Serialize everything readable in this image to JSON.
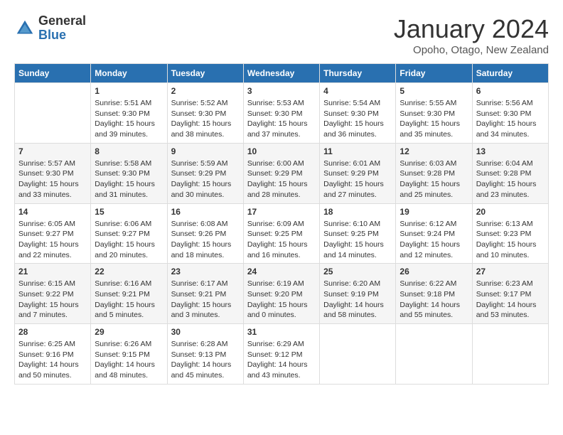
{
  "logo": {
    "general": "General",
    "blue": "Blue"
  },
  "title": "January 2024",
  "location": "Opoho, Otago, New Zealand",
  "days_of_week": [
    "Sunday",
    "Monday",
    "Tuesday",
    "Wednesday",
    "Thursday",
    "Friday",
    "Saturday"
  ],
  "weeks": [
    [
      {
        "day": "",
        "info": ""
      },
      {
        "day": "1",
        "info": "Sunrise: 5:51 AM\nSunset: 9:30 PM\nDaylight: 15 hours\nand 39 minutes."
      },
      {
        "day": "2",
        "info": "Sunrise: 5:52 AM\nSunset: 9:30 PM\nDaylight: 15 hours\nand 38 minutes."
      },
      {
        "day": "3",
        "info": "Sunrise: 5:53 AM\nSunset: 9:30 PM\nDaylight: 15 hours\nand 37 minutes."
      },
      {
        "day": "4",
        "info": "Sunrise: 5:54 AM\nSunset: 9:30 PM\nDaylight: 15 hours\nand 36 minutes."
      },
      {
        "day": "5",
        "info": "Sunrise: 5:55 AM\nSunset: 9:30 PM\nDaylight: 15 hours\nand 35 minutes."
      },
      {
        "day": "6",
        "info": "Sunrise: 5:56 AM\nSunset: 9:30 PM\nDaylight: 15 hours\nand 34 minutes."
      }
    ],
    [
      {
        "day": "7",
        "info": "Sunrise: 5:57 AM\nSunset: 9:30 PM\nDaylight: 15 hours\nand 33 minutes."
      },
      {
        "day": "8",
        "info": "Sunrise: 5:58 AM\nSunset: 9:30 PM\nDaylight: 15 hours\nand 31 minutes."
      },
      {
        "day": "9",
        "info": "Sunrise: 5:59 AM\nSunset: 9:29 PM\nDaylight: 15 hours\nand 30 minutes."
      },
      {
        "day": "10",
        "info": "Sunrise: 6:00 AM\nSunset: 9:29 PM\nDaylight: 15 hours\nand 28 minutes."
      },
      {
        "day": "11",
        "info": "Sunrise: 6:01 AM\nSunset: 9:29 PM\nDaylight: 15 hours\nand 27 minutes."
      },
      {
        "day": "12",
        "info": "Sunrise: 6:03 AM\nSunset: 9:28 PM\nDaylight: 15 hours\nand 25 minutes."
      },
      {
        "day": "13",
        "info": "Sunrise: 6:04 AM\nSunset: 9:28 PM\nDaylight: 15 hours\nand 23 minutes."
      }
    ],
    [
      {
        "day": "14",
        "info": "Sunrise: 6:05 AM\nSunset: 9:27 PM\nDaylight: 15 hours\nand 22 minutes."
      },
      {
        "day": "15",
        "info": "Sunrise: 6:06 AM\nSunset: 9:27 PM\nDaylight: 15 hours\nand 20 minutes."
      },
      {
        "day": "16",
        "info": "Sunrise: 6:08 AM\nSunset: 9:26 PM\nDaylight: 15 hours\nand 18 minutes."
      },
      {
        "day": "17",
        "info": "Sunrise: 6:09 AM\nSunset: 9:25 PM\nDaylight: 15 hours\nand 16 minutes."
      },
      {
        "day": "18",
        "info": "Sunrise: 6:10 AM\nSunset: 9:25 PM\nDaylight: 15 hours\nand 14 minutes."
      },
      {
        "day": "19",
        "info": "Sunrise: 6:12 AM\nSunset: 9:24 PM\nDaylight: 15 hours\nand 12 minutes."
      },
      {
        "day": "20",
        "info": "Sunrise: 6:13 AM\nSunset: 9:23 PM\nDaylight: 15 hours\nand 10 minutes."
      }
    ],
    [
      {
        "day": "21",
        "info": "Sunrise: 6:15 AM\nSunset: 9:22 PM\nDaylight: 15 hours\nand 7 minutes."
      },
      {
        "day": "22",
        "info": "Sunrise: 6:16 AM\nSunset: 9:21 PM\nDaylight: 15 hours\nand 5 minutes."
      },
      {
        "day": "23",
        "info": "Sunrise: 6:17 AM\nSunset: 9:21 PM\nDaylight: 15 hours\nand 3 minutes."
      },
      {
        "day": "24",
        "info": "Sunrise: 6:19 AM\nSunset: 9:20 PM\nDaylight: 15 hours\nand 0 minutes."
      },
      {
        "day": "25",
        "info": "Sunrise: 6:20 AM\nSunset: 9:19 PM\nDaylight: 14 hours\nand 58 minutes."
      },
      {
        "day": "26",
        "info": "Sunrise: 6:22 AM\nSunset: 9:18 PM\nDaylight: 14 hours\nand 55 minutes."
      },
      {
        "day": "27",
        "info": "Sunrise: 6:23 AM\nSunset: 9:17 PM\nDaylight: 14 hours\nand 53 minutes."
      }
    ],
    [
      {
        "day": "28",
        "info": "Sunrise: 6:25 AM\nSunset: 9:16 PM\nDaylight: 14 hours\nand 50 minutes."
      },
      {
        "day": "29",
        "info": "Sunrise: 6:26 AM\nSunset: 9:15 PM\nDaylight: 14 hours\nand 48 minutes."
      },
      {
        "day": "30",
        "info": "Sunrise: 6:28 AM\nSunset: 9:13 PM\nDaylight: 14 hours\nand 45 minutes."
      },
      {
        "day": "31",
        "info": "Sunrise: 6:29 AM\nSunset: 9:12 PM\nDaylight: 14 hours\nand 43 minutes."
      },
      {
        "day": "",
        "info": ""
      },
      {
        "day": "",
        "info": ""
      },
      {
        "day": "",
        "info": ""
      }
    ]
  ]
}
